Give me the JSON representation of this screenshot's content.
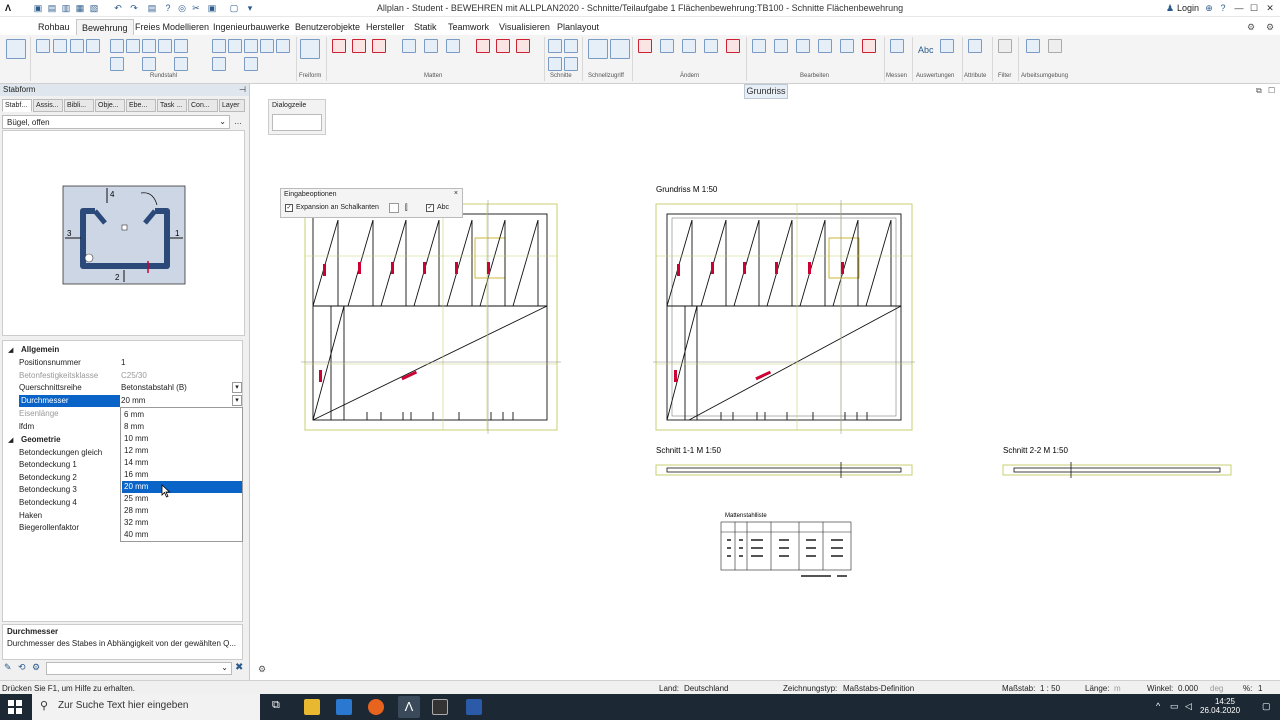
{
  "app": {
    "title": "Allplan - Student - BEWEHREN mit ALLPLAN2020 - Schnitte/Teilaufgabe 1 Flächenbewehrung:TB100 - Schnitte Flächenbewehrung",
    "login": "Login"
  },
  "ribbon": {
    "tabs": [
      "Rohbau",
      "Bewehrung",
      "Freies Modellieren",
      "Ingenieurbauwerke",
      "Benutzerobjekte",
      "Hersteller",
      "Statik",
      "Teamwork",
      "Visualisieren",
      "Planlayout"
    ],
    "active_tab": "Bewehrung",
    "groups": [
      "Rundstahl",
      "Freiform",
      "Matten",
      "Schnitte",
      "Schnellzugriff",
      "Ändern",
      "Bearbeiten",
      "Messen",
      "Auswertungen",
      "Attribute",
      "Filter",
      "Arbeitsumgebung"
    ],
    "abc": "Abc"
  },
  "panel": {
    "title": "Stabform",
    "tabs": [
      "Stabf...",
      "Assis...",
      "Bibli...",
      "Obje...",
      "Ebe...",
      "Task ...",
      "Con...",
      "Layer"
    ],
    "shape_select": "Bügel, offen",
    "preview_labels": [
      "4",
      "3",
      "1",
      "2"
    ],
    "properties": {
      "group_general": "Allgemein",
      "rows": [
        {
          "k": "Positionsnummer",
          "v": "1"
        },
        {
          "k": "Betonfestigkeitsklasse",
          "v": "C25/30"
        },
        {
          "k": "Querschnittsreihe",
          "v": "Betonstabstahl (B)"
        },
        {
          "k": "Durchmesser",
          "v": "20 mm"
        },
        {
          "k": "Eisenlänge",
          "v": ""
        },
        {
          "k": "lfdm",
          "v": ""
        }
      ],
      "group_geometry": "Geometrie",
      "geo_rows": [
        "Betondeckungen gleich",
        "Betondeckung 1",
        "Betondeckung 2",
        "Betondeckung 3",
        "Betondeckung 4",
        "Haken",
        "Biegerollenfaktor"
      ]
    },
    "dropdown_options": [
      "6 mm",
      "8 mm",
      "10 mm",
      "12 mm",
      "14 mm",
      "16 mm",
      "20 mm",
      "25 mm",
      "28 mm",
      "32 mm",
      "40 mm"
    ],
    "dropdown_selected": "20 mm",
    "desc_title": "Durchmesser",
    "desc_text": "Durchmesser des Stabes in Abhängigkeit von der gewählten Q..."
  },
  "canvas": {
    "view_label": "Grundriss",
    "dialog_label": "Dialogzeile",
    "options_title": "Eingabeoptionen",
    "option_expansion": "Expansion an Schalkanten",
    "option_abc": "Abc",
    "plan_title": "Grundriss M 1:50",
    "section1": "Schnitt 1-1 M 1:50",
    "section2": "Schnitt 2-2 M 1:50",
    "table_title": "Mattenstahlliste"
  },
  "status": {
    "hint": "Drücken Sie F1, um Hilfe zu erhalten.",
    "land_label": "Land:",
    "land": "Deutschland",
    "typ_label": "Zeichnungstyp:",
    "typ": "Maßstabs-Definition",
    "massstab_label": "Maßstab:",
    "massstab": "1 : 50",
    "laenge_label": "Länge:",
    "laenge_unit": "m",
    "winkel_label": "Winkel:",
    "winkel": "0.000",
    "winkel_unit": "deg",
    "percent_label": "%:",
    "percent": "1"
  },
  "taskbar": {
    "search": "Zur Suche Text hier eingeben",
    "time": "14:25",
    "date": "26.04.2020"
  }
}
